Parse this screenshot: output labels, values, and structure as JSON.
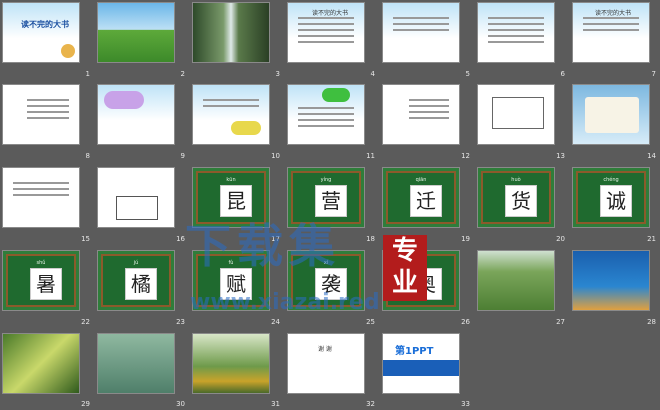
{
  "app": {
    "title": "读不完的大书 slide sorter"
  },
  "slides": [
    {
      "n": "1",
      "title": "读不完的大书"
    },
    {
      "n": "2"
    },
    {
      "n": "3"
    },
    {
      "n": "4",
      "title": "读不完的大书"
    },
    {
      "n": "5"
    },
    {
      "n": "6"
    },
    {
      "n": "7",
      "title": "读不完的大书"
    },
    {
      "n": "8"
    },
    {
      "n": "9"
    },
    {
      "n": "10"
    },
    {
      "n": "11"
    },
    {
      "n": "12"
    },
    {
      "n": "13"
    },
    {
      "n": "14"
    },
    {
      "n": "15"
    },
    {
      "n": "16"
    },
    {
      "n": "17",
      "pinyin": "kūn",
      "char": "昆"
    },
    {
      "n": "18",
      "pinyin": "yíng",
      "char": "营"
    },
    {
      "n": "19",
      "pinyin": "qiān",
      "char": "迁"
    },
    {
      "n": "20",
      "pinyin": "huò",
      "char": "货"
    },
    {
      "n": "21",
      "pinyin": "chéng",
      "char": "诚"
    },
    {
      "n": "22",
      "pinyin": "shǔ",
      "char": "暑"
    },
    {
      "n": "23",
      "pinyin": "jú",
      "char": "橘"
    },
    {
      "n": "24",
      "pinyin": "fù",
      "char": "赋"
    },
    {
      "n": "25",
      "pinyin": "xí",
      "char": "袭"
    },
    {
      "n": "26",
      "pinyin": "ào",
      "char": "奥"
    },
    {
      "n": "27"
    },
    {
      "n": "28"
    },
    {
      "n": "29"
    },
    {
      "n": "30"
    },
    {
      "n": "31"
    },
    {
      "n": "32",
      "title": "谢 谢"
    },
    {
      "n": "33",
      "logo": "第1PPT"
    }
  ],
  "watermark": {
    "text": "下载集",
    "url": "www.xiazai.red",
    "badge": "专业"
  }
}
